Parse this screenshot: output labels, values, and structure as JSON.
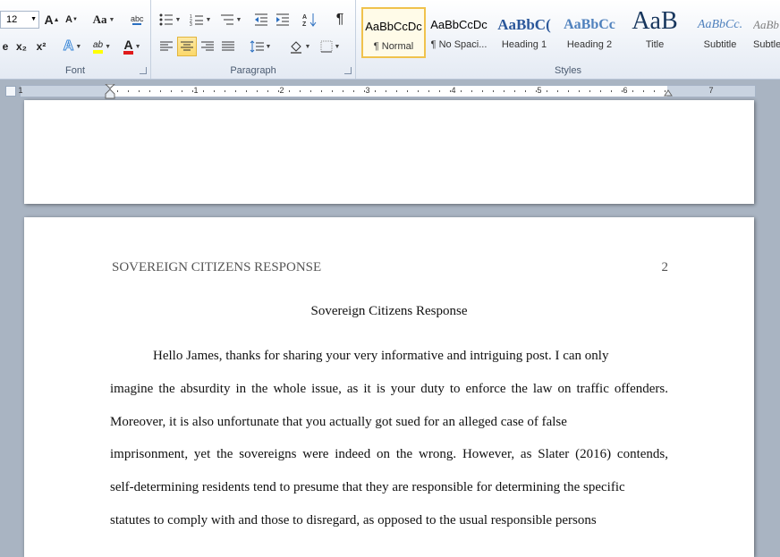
{
  "ribbon": {
    "font_group": {
      "label": "Font",
      "font_size": "12",
      "grow_font_label": "A",
      "shrink_font_label": "A",
      "change_case_label": "Aa",
      "subscript_label": "x₂",
      "superscript_label": "x²",
      "font_color_label": "A",
      "highlight_label": "ab"
    },
    "paragraph_group": {
      "label": "Paragraph",
      "show_marks_label": "¶"
    },
    "styles_group": {
      "label": "Styles",
      "items": [
        {
          "preview": "AaBbCcDc",
          "name": "¶ Normal",
          "selected": true
        },
        {
          "preview": "AaBbCcDc",
          "name": "¶ No Spaci..."
        },
        {
          "preview": "AaBbC(",
          "name": "Heading 1"
        },
        {
          "preview": "AaBbCc",
          "name": "Heading 2"
        },
        {
          "preview": "AaB",
          "name": "Title"
        },
        {
          "preview": "AaBbCc.",
          "name": "Subtitle"
        },
        {
          "preview": "AaBb",
          "name": "Subtle"
        }
      ]
    },
    "colors": {
      "font_color": "#e01b1b",
      "highlight": "#ffff00",
      "heading_blue": "#2b579a",
      "selected_border": "#f0c24c"
    }
  },
  "ruler": {
    "numbers": [
      "1",
      "1",
      "2",
      "3",
      "4",
      "5",
      "6",
      "7"
    ]
  },
  "document": {
    "header": {
      "running_head": "SOVEREIGN CITIZENS RESPONSE",
      "page_number": "2"
    },
    "title": "Sovereign Citizens Response",
    "body_lines": [
      "Hello James, thanks for sharing your very informative and intriguing post. I can only",
      "imagine the absurdity in the whole issue, as it is your duty to enforce the law on traffic offenders.",
      "Moreover, it is also unfortunate that you actually got sued for an alleged case of false",
      "imprisonment, yet the sovereigns were indeed on the wrong. However, as Slater (2016) contends,",
      "self-determining residents tend to presume that they are responsible for determining the specific",
      "statutes to comply with and those to disregard, as opposed to the usual responsible persons"
    ]
  }
}
